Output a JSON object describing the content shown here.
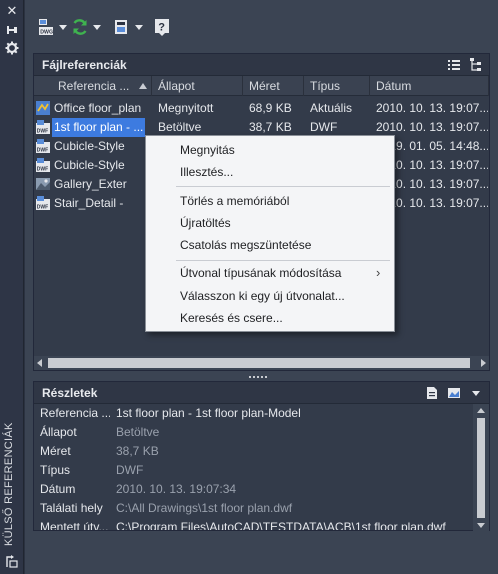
{
  "palette_title": "KÜLSŐ REFERENCIÁK",
  "file_refs": {
    "title": "Fájlreferenciák",
    "columns": [
      "Referencia ...",
      "Állapot",
      "Méret",
      "Típus",
      "Dátum"
    ],
    "rows": [
      {
        "name": "Office floor_plan",
        "status": "Megnyitott",
        "size": "68,9 KB",
        "type": "Aktuális",
        "date": "2010. 10. 13. 19:07..."
      },
      {
        "name": "1st floor plan - ...",
        "status": "Betöltve",
        "size": "38,7 KB",
        "type": "DWF",
        "date": "2010. 10. 13. 19:07..."
      },
      {
        "name": "Cubicle-Style",
        "status": "",
        "size": "",
        "type": "",
        "date": "2019. 01. 05. 14:48..."
      },
      {
        "name": "Cubicle-Style",
        "status": "",
        "size": "",
        "type": "",
        "date": "2010. 10. 13. 19:07..."
      },
      {
        "name": "Gallery_Exter",
        "status": "",
        "size": "",
        "type": "",
        "date": "2010. 10. 13. 19:07..."
      },
      {
        "name": "Stair_Detail -",
        "status": "",
        "size": "",
        "type": "",
        "date": "2010. 10. 13. 19:07..."
      }
    ]
  },
  "context_menu": {
    "items": [
      "Megnyitás",
      "Illesztés...",
      "Törlés a memóriából",
      "Újratöltés",
      "Csatolás megszüntetése",
      "Útvonal típusának módosítása",
      "Válasszon ki egy új útvonalat...",
      "Keresés és csere..."
    ],
    "submenu_arrow": "›"
  },
  "details": {
    "title": "Részletek",
    "rows": [
      {
        "key": "Referencia ...",
        "value": "1st floor plan - 1st floor plan-Model"
      },
      {
        "key": "Állapot",
        "value": "Betöltve"
      },
      {
        "key": "Méret",
        "value": "38,7 KB"
      },
      {
        "key": "Típus",
        "value": "DWF"
      },
      {
        "key": "Dátum",
        "value": "2010. 10. 13. 19:07:34"
      },
      {
        "key": "Találati hely",
        "value": "C:\\All Drawings\\1st floor plan.dwf"
      },
      {
        "key": "Mentett útv...",
        "value": "C:\\Program Files\\AutoCAD\\TESTDATA\\ACB\\1st floor plan.dwf"
      }
    ]
  },
  "icons": {
    "close": "close-icon",
    "pin": "pin-icon",
    "settings": "gear-icon",
    "attach": "attach-dwg-icon",
    "refresh": "refresh-icon",
    "change_path": "change-path-icon",
    "help": "help-icon",
    "list_view": "list-view-icon",
    "tree_view": "tree-view-icon",
    "details_view": "details-view-icon",
    "preview": "preview-icon",
    "palette_props": "palette-properties-icon"
  },
  "colors": {
    "selection": "#3d7be0",
    "accent_green": "#3fb34f",
    "panel": "#333b4a"
  }
}
